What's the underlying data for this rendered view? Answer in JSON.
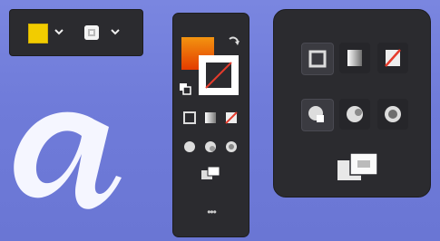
{
  "topbar": {
    "fill_color": "#f2cc00",
    "stroke_color": "#f4f4f4",
    "fill_dropdown_icon": "chevron-down-icon",
    "stroke_dropdown_icon": "chevron-down-icon"
  },
  "toolbox": {
    "fill_gradient": [
      "#f48a10",
      "#e23a00"
    ],
    "stroke_color": "#ffffff",
    "swap_icon": "swap-arrow-icon",
    "default_icon": "default-fill-stroke-icon",
    "modes": [
      "color-mode-icon",
      "gradient-mode-icon",
      "none-mode-icon"
    ],
    "draw_modes": [
      "draw-normal-icon",
      "draw-behind-icon",
      "draw-inside-icon"
    ],
    "screen_mode_icon": "screen-mode-icon",
    "more_icon": "more-options-icon",
    "more_label": "•••"
  },
  "flyout": {
    "row1": [
      "color-mode-icon",
      "gradient-mode-icon",
      "none-mode-icon"
    ],
    "row2": [
      "draw-normal-icon",
      "draw-behind-icon",
      "draw-inside-icon"
    ],
    "screen_mode_icon": "screen-mode-icon"
  },
  "colors": {
    "panel_bg": "#2b2b2f",
    "cell_bg": "#26262a",
    "cell_selected_bg": "#3b3b41",
    "canvas_bg": "#7480dc",
    "none_slash": "#e53b2c"
  }
}
